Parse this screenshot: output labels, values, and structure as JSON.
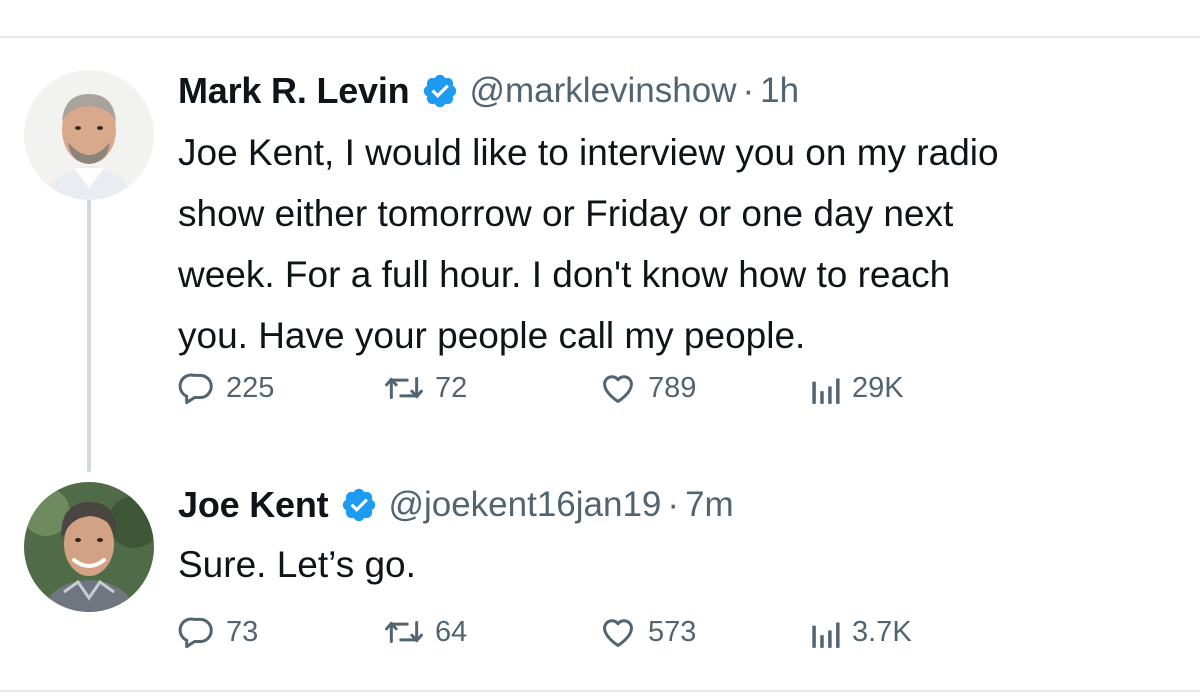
{
  "colors": {
    "text": "#0f1419",
    "secondary": "#536471",
    "verified": "#1d9bf0",
    "divider": "#e7e9ea",
    "thread": "#cfd9de"
  },
  "icons": {
    "reply": "speech-bubble-icon",
    "repost": "repost-arrows-icon",
    "like": "heart-icon",
    "views": "bar-chart-icon",
    "verified": "verified-badge-icon"
  },
  "tweets": [
    {
      "name": "Mark R. Levin",
      "handle": "@marklevinshow",
      "separator": "·",
      "time": "1h",
      "text": "Joe Kent, I would like to interview you on my radio\nshow either tomorrow or Friday or one day next\nweek.  For a full hour.  I don't know how to reach\nyou.  Have your people call my people.",
      "replies": "225",
      "reposts": "72",
      "likes": "789",
      "views": "29K"
    },
    {
      "name": "Joe Kent",
      "handle": "@joekent16jan19",
      "separator": "·",
      "time": "7m",
      "text": "Sure. Let’s go.",
      "replies": "73",
      "reposts": "64",
      "likes": "573",
      "views": "3.7K"
    }
  ]
}
